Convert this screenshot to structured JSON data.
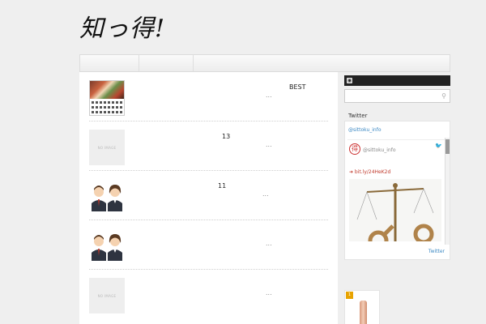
{
  "site": {
    "logo_text": "知っ得!"
  },
  "posts": [
    {
      "title": "BEST",
      "more": "..."
    },
    {
      "title": "13",
      "more": "..."
    },
    {
      "title": "11",
      "more": "..."
    },
    {
      "title": "",
      "more": "..."
    },
    {
      "title": "",
      "more": "..."
    }
  ],
  "placeholders": {
    "no_image": "NO IMAGE"
  },
  "sidebar": {
    "twitter_heading": "Twitter",
    "twitter_widget": {
      "user_link": "@sittoku_info",
      "handle": "@sittoku_info",
      "avatar_glyph": "得",
      "tweet_link": "➜ bit.ly/24HeK2d",
      "footer_link": "Twitter"
    },
    "product_rank": "1"
  },
  "colors": {
    "accent_link": "#3b88c3",
    "tweet_link": "#c0392b",
    "rank_badge": "#e8a300"
  }
}
